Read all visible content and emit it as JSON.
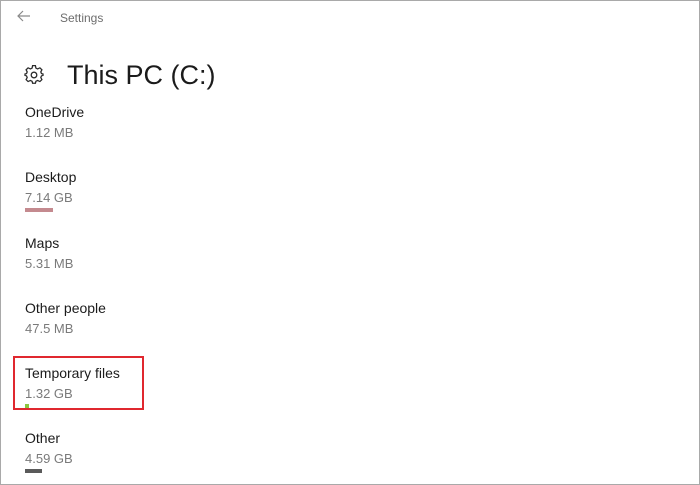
{
  "window": {
    "title": "Settings"
  },
  "header": {
    "title": "This PC (C:)",
    "icon": "gear-icon"
  },
  "storage_items": [
    {
      "name": "OneDrive",
      "size": "1.12 MB",
      "usage_fraction": 0,
      "color": ""
    },
    {
      "name": "Desktop",
      "size": "7.14 GB",
      "usage_fraction": 0.05,
      "color": "#c48a8f"
    },
    {
      "name": "Maps",
      "size": "5.31 MB",
      "usage_fraction": 0,
      "color": ""
    },
    {
      "name": "Other people",
      "size": "47.5 MB",
      "usage_fraction": 0,
      "color": ""
    },
    {
      "name": "Temporary files",
      "size": "1.32 GB",
      "usage_fraction": 0.008,
      "color": "#8cc63f",
      "highlighted": true
    },
    {
      "name": "Other",
      "size": "4.59 GB",
      "usage_fraction": 0.03,
      "color": "#5a5a5a"
    }
  ],
  "colors": {
    "highlight_border": "#e0282f"
  }
}
